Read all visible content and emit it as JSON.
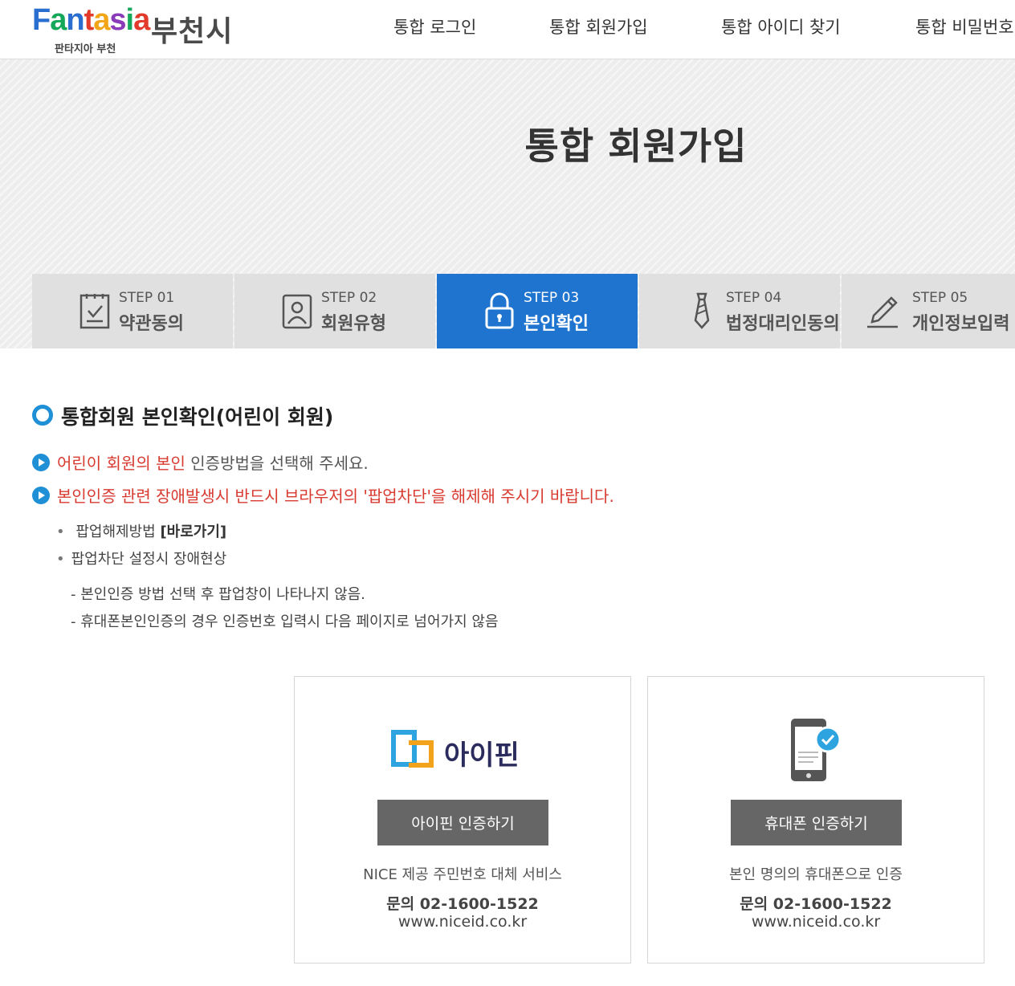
{
  "header": {
    "logo": {
      "brand": "Fantasia",
      "city": "부천시",
      "sub": "판타지아 부천"
    },
    "nav": [
      "통합 로그인",
      "통합 회원가입",
      "통합 아이디 찾기",
      "통합 비밀번호"
    ]
  },
  "banner": {
    "title": "통합 회원가입"
  },
  "steps": [
    {
      "num": "STEP 01",
      "label": "약관동의",
      "icon": "checklist-icon",
      "active": false
    },
    {
      "num": "STEP 02",
      "label": "회원유형",
      "icon": "user-card-icon",
      "active": false
    },
    {
      "num": "STEP 03",
      "label": "본인확인",
      "icon": "lock-icon",
      "active": true
    },
    {
      "num": "STEP 04",
      "label": "법정대리인동의",
      "icon": "tie-icon",
      "active": false
    },
    {
      "num": "STEP 05",
      "label": "개인정보입력",
      "icon": "pencil-icon",
      "active": false
    }
  ],
  "section": {
    "title": "통합회원 본인확인(어린이 회원)"
  },
  "notices": {
    "n1_red": "어린이 회원의 본인",
    "n1_rest": " 인증방법을 선택해 주세요.",
    "n2": "본인인증 관련 장애발생시 반드시 브라우저의 '팝업차단'을 해제해 주시기 바랍니다."
  },
  "bullets": {
    "b1_text": "팝업해제방법 ",
    "b1_link": "[바로가기]",
    "b2": "팝업차단 설정시 장애현상",
    "d1": "- 본인인증 방법 선택 후 팝업창이 나타나지 않음.",
    "d2": "- 휴대폰본인인증의 경우 인증번호 입력시 다음 페이지로 넘어가지 않음"
  },
  "cards": [
    {
      "logo_text": "아이핀",
      "button": "아이핀 인증하기",
      "desc": "NICE 제공 주민번호 대체 서비스",
      "tel": "문의 02-1600-1522",
      "url": "www.niceid.co.kr"
    },
    {
      "button": "휴대폰 인증하기",
      "desc": "본인 명의의 휴대폰으로 인증",
      "tel": "문의 02-1600-1522",
      "url": "www.niceid.co.kr"
    }
  ],
  "colors": {
    "accent": "#1f74cf",
    "bullet_blue": "#1f8fd6",
    "alert_red": "#d83a30",
    "button_gray": "#666666"
  }
}
